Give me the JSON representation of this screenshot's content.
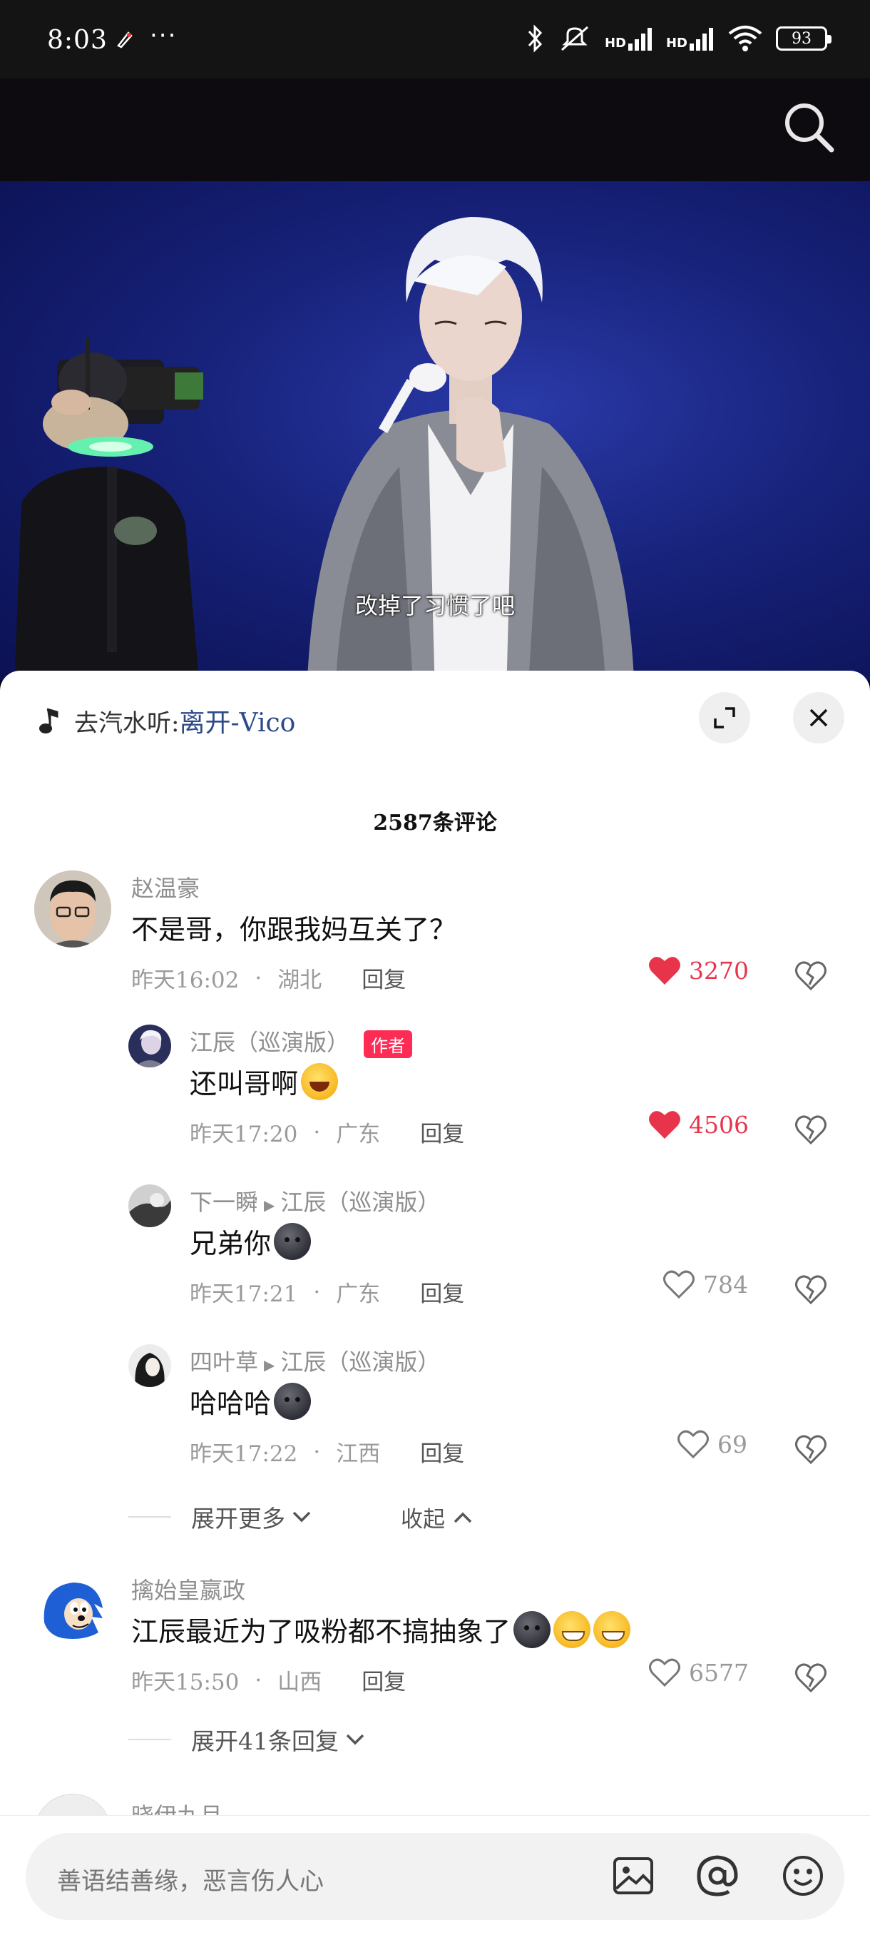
{
  "status_bar": {
    "time": "8:03",
    "more": "···",
    "network_label": "HD",
    "battery": "93"
  },
  "video": {
    "subtitle": "改掉了习惯了吧"
  },
  "music": {
    "prefix": "去汽水听:",
    "title": "离开-Vico"
  },
  "comment_count": "2587条评论",
  "comments": [
    {
      "username": "赵温豪",
      "text": "不是哥，你跟我妈互关了？",
      "time": "昨天16:02",
      "location": "湖北",
      "reply_label": "回复",
      "likes": "3270",
      "liked": true,
      "replies": [
        {
          "username": "江辰（巡演版）",
          "badge": "作者",
          "text": "还叫哥啊",
          "emoji": "laugh",
          "time": "昨天17:20",
          "location": "广东",
          "reply_label": "回复",
          "likes": "4506",
          "liked": true
        },
        {
          "username": "下一瞬",
          "reply_to": "江辰（巡演版）",
          "text": "兄弟你",
          "emoji": "dark",
          "time": "昨天17:21",
          "location": "广东",
          "reply_label": "回复",
          "likes": "784",
          "liked": false
        },
        {
          "username": "四叶草",
          "reply_to": "江辰（巡演版）",
          "text": "哈哈哈",
          "emoji": "dark",
          "time": "昨天17:22",
          "location": "江西",
          "reply_label": "回复",
          "likes": "69",
          "liked": false
        }
      ],
      "expand_more": "展开更多",
      "collapse": "收起"
    },
    {
      "username": "擒始皇嬴政",
      "text": "江辰最近为了吸粉都不搞抽象了",
      "time": "昨天15:50",
      "location": "山西",
      "reply_label": "回复",
      "likes": "6577",
      "liked": false,
      "expand_replies": "展开41条回复"
    },
    {
      "username": "晓伊九月"
    }
  ],
  "input": {
    "placeholder": "善语结善缘，恶言伤人心"
  },
  "colors": {
    "like_red": "#e8344b",
    "author_badge": "#fe2c55",
    "music_title": "#2c4a8a"
  }
}
